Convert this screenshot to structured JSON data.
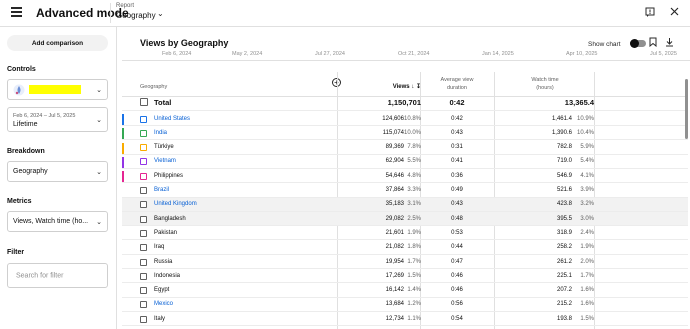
{
  "header": {
    "title": "Advanced mode",
    "report_label": "Report",
    "report_value": "Geography"
  },
  "sidebar": {
    "add_comparison": "Add comparison",
    "controls_label": "Controls",
    "date_range_small": "Feb 6, 2024 – Jul 5, 2025",
    "date_range": "Lifetime",
    "breakdown_label": "Breakdown",
    "breakdown_value": "Geography",
    "metrics_label": "Metrics",
    "metrics_value": "Views, Watch time (ho...",
    "filter_label": "Filter",
    "filter_placeholder": "Search for filter"
  },
  "main": {
    "title": "Views by Geography",
    "show_chart": "Show chart",
    "timeline": [
      "Feb 6, 2024",
      "May 2, 2024",
      "Jul 27, 2024",
      "Oct 21, 2024",
      "Jan 14, 2025",
      "Apr 10, 2025",
      "Jul 5, 2025"
    ]
  },
  "table": {
    "headers": {
      "geography": "Geography",
      "views": "Views",
      "avd_line1": "Average view",
      "avd_line2": "duration",
      "wt_line1": "Watch time",
      "wt_line2": "(hours)"
    },
    "total": {
      "name": "Total",
      "views": "1,150,701",
      "avd": "0:42",
      "wt": "13,365.4"
    },
    "rows": [
      {
        "name": "United States",
        "views": "124,606",
        "vpct": "10.8%",
        "avd": "0:42",
        "wt": "1,461.4",
        "wpct": "10.9%",
        "color": "#1a73e8",
        "link": true
      },
      {
        "name": "India",
        "views": "115,074",
        "vpct": "10.0%",
        "avd": "0:43",
        "wt": "1,390.6",
        "wpct": "10.4%",
        "color": "#34a853",
        "link": true
      },
      {
        "name": "Türkiye",
        "views": "89,369",
        "vpct": "7.8%",
        "avd": "0:31",
        "wt": "782.8",
        "wpct": "5.9%",
        "color": "#f9ab00",
        "link": false
      },
      {
        "name": "Vietnam",
        "views": "62,904",
        "vpct": "5.5%",
        "avd": "0:41",
        "wt": "719.0",
        "wpct": "5.4%",
        "color": "#9334e6",
        "link": true
      },
      {
        "name": "Philippines",
        "views": "54,646",
        "vpct": "4.8%",
        "avd": "0:36",
        "wt": "546.9",
        "wpct": "4.1%",
        "color": "#e52592",
        "link": false
      },
      {
        "name": "Brazil",
        "views": "37,864",
        "vpct": "3.3%",
        "avd": "0:49",
        "wt": "521.6",
        "wpct": "3.9%",
        "color": "",
        "link": true
      },
      {
        "name": "United Kingdom",
        "views": "35,183",
        "vpct": "3.1%",
        "avd": "0:43",
        "wt": "423.8",
        "wpct": "3.2%",
        "color": "",
        "link": true
      },
      {
        "name": "Bangladesh",
        "views": "29,082",
        "vpct": "2.5%",
        "avd": "0:48",
        "wt": "395.5",
        "wpct": "3.0%",
        "color": "",
        "link": false
      },
      {
        "name": "Pakistan",
        "views": "21,601",
        "vpct": "1.9%",
        "avd": "0:53",
        "wt": "318.9",
        "wpct": "2.4%",
        "color": "",
        "link": false
      },
      {
        "name": "Iraq",
        "views": "21,082",
        "vpct": "1.8%",
        "avd": "0:44",
        "wt": "258.2",
        "wpct": "1.9%",
        "color": "",
        "link": false
      },
      {
        "name": "Russia",
        "views": "19,954",
        "vpct": "1.7%",
        "avd": "0:47",
        "wt": "261.2",
        "wpct": "2.0%",
        "color": "",
        "link": false
      },
      {
        "name": "Indonesia",
        "views": "17,269",
        "vpct": "1.5%",
        "avd": "0:46",
        "wt": "225.1",
        "wpct": "1.7%",
        "color": "",
        "link": false
      },
      {
        "name": "Egypt",
        "views": "16,142",
        "vpct": "1.4%",
        "avd": "0:46",
        "wt": "207.2",
        "wpct": "1.6%",
        "color": "",
        "link": false
      },
      {
        "name": "Mexico",
        "views": "13,684",
        "vpct": "1.2%",
        "avd": "0:56",
        "wt": "215.2",
        "wpct": "1.6%",
        "color": "",
        "link": true
      },
      {
        "name": "Italy",
        "views": "12,734",
        "vpct": "1.1%",
        "avd": "0:54",
        "wt": "193.8",
        "wpct": "1.5%",
        "color": "",
        "link": false
      }
    ]
  }
}
